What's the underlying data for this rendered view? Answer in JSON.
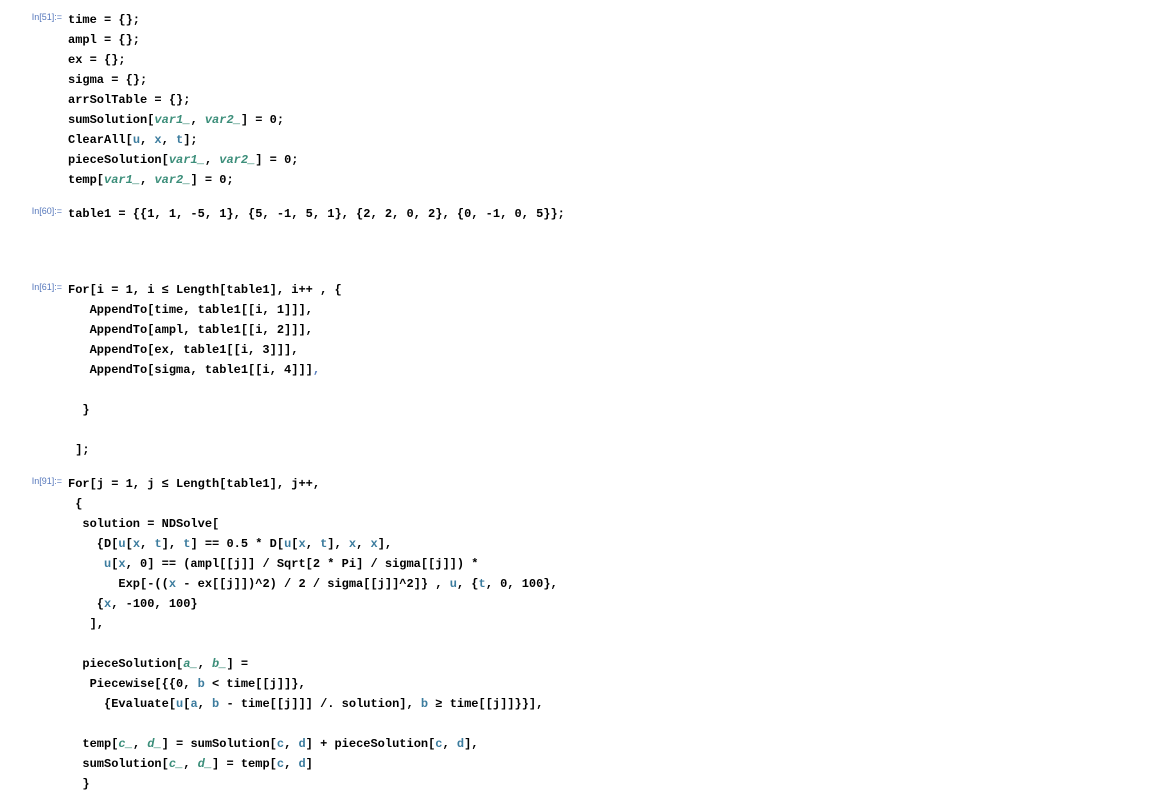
{
  "cells": [
    {
      "label": "In[51]:=",
      "lines": [
        [
          {
            "t": "time = {};",
            "c": "sym"
          }
        ],
        [
          {
            "t": "ampl = {};",
            "c": "sym"
          }
        ],
        [
          {
            "t": "ex = {};",
            "c": "sym"
          }
        ],
        [
          {
            "t": "sigma = {};",
            "c": "sym"
          }
        ],
        [
          {
            "t": "arrSolTable = {};",
            "c": "sym"
          }
        ],
        [
          {
            "t": "sumSolution[",
            "c": "sym"
          },
          {
            "t": "var1_",
            "c": "patt"
          },
          {
            "t": ", ",
            "c": "sym"
          },
          {
            "t": "var2_",
            "c": "patt"
          },
          {
            "t": "] = 0;",
            "c": "sym"
          }
        ],
        [
          {
            "t": "ClearAll[",
            "c": "sym"
          },
          {
            "t": "u",
            "c": "blue"
          },
          {
            "t": ", ",
            "c": "sym"
          },
          {
            "t": "x",
            "c": "blue"
          },
          {
            "t": ", ",
            "c": "sym"
          },
          {
            "t": "t",
            "c": "blue"
          },
          {
            "t": "];",
            "c": "sym"
          }
        ],
        [
          {
            "t": "pieceSolution[",
            "c": "sym"
          },
          {
            "t": "var1_",
            "c": "patt"
          },
          {
            "t": ", ",
            "c": "sym"
          },
          {
            "t": "var2_",
            "c": "patt"
          },
          {
            "t": "] = 0;",
            "c": "sym"
          }
        ],
        [
          {
            "t": "temp[",
            "c": "sym"
          },
          {
            "t": "var1_",
            "c": "patt"
          },
          {
            "t": ", ",
            "c": "sym"
          },
          {
            "t": "var2_",
            "c": "patt"
          },
          {
            "t": "] = 0;",
            "c": "sym"
          }
        ]
      ]
    },
    {
      "label": "In[60]:=",
      "lines": [
        [
          {
            "t": "table1 = {{1, 1, -5, 1}, {5, -1, 5, 1}, {2, 2, 0, 2}, {0, -1, 0, 5}};",
            "c": "sym"
          }
        ]
      ]
    },
    {
      "label": "In[61]:=",
      "lines": [
        [
          {
            "t": "For[i = 1, i ≤ Length[table1], i++ , {",
            "c": "sym"
          }
        ],
        [
          {
            "t": "   AppendTo[time, table1[[i, 1]]],",
            "c": "sym"
          }
        ],
        [
          {
            "t": "   AppendTo[ampl, table1[[i, 2]]],",
            "c": "sym"
          }
        ],
        [
          {
            "t": "   AppendTo[ex, table1[[i, 3]]],",
            "c": "sym"
          }
        ],
        [
          {
            "t": "   AppendTo[sigma, table1[[i, 4]]]",
            "c": "sym"
          },
          {
            "t": ",",
            "c": "comma-trail"
          }
        ],
        [
          {
            "t": " ",
            "c": "sym"
          }
        ],
        [
          {
            "t": "  }",
            "c": "sym"
          }
        ],
        [
          {
            "t": " ",
            "c": "sym"
          }
        ],
        [
          {
            "t": " ];",
            "c": "sym"
          }
        ]
      ]
    },
    {
      "label": "In[91]:=",
      "lines": [
        [
          {
            "t": "For[j = 1, j ≤ Length[table1], j++,",
            "c": "sym"
          }
        ],
        [
          {
            "t": " {",
            "c": "sym"
          }
        ],
        [
          {
            "t": "  solution = NDSolve[",
            "c": "sym"
          }
        ],
        [
          {
            "t": "    {D[",
            "c": "sym"
          },
          {
            "t": "u",
            "c": "blue"
          },
          {
            "t": "[",
            "c": "sym"
          },
          {
            "t": "x",
            "c": "blue"
          },
          {
            "t": ", ",
            "c": "sym"
          },
          {
            "t": "t",
            "c": "blue"
          },
          {
            "t": "], ",
            "c": "sym"
          },
          {
            "t": "t",
            "c": "blue"
          },
          {
            "t": "] == 0.5 * D[",
            "c": "sym"
          },
          {
            "t": "u",
            "c": "blue"
          },
          {
            "t": "[",
            "c": "sym"
          },
          {
            "t": "x",
            "c": "blue"
          },
          {
            "t": ", ",
            "c": "sym"
          },
          {
            "t": "t",
            "c": "blue"
          },
          {
            "t": "], ",
            "c": "sym"
          },
          {
            "t": "x",
            "c": "blue"
          },
          {
            "t": ", ",
            "c": "sym"
          },
          {
            "t": "x",
            "c": "blue"
          },
          {
            "t": "],",
            "c": "sym"
          }
        ],
        [
          {
            "t": "     ",
            "c": "sym"
          },
          {
            "t": "u",
            "c": "blue"
          },
          {
            "t": "[",
            "c": "sym"
          },
          {
            "t": "x",
            "c": "blue"
          },
          {
            "t": ", 0] == (ampl[[j]] / Sqrt[2 * Pi] / sigma[[j]]) *",
            "c": "sym"
          }
        ],
        [
          {
            "t": "       Exp[-((",
            "c": "sym"
          },
          {
            "t": "x",
            "c": "blue"
          },
          {
            "t": " - ex[[j]])^2) / 2 / sigma[[j]]^2]} , ",
            "c": "sym"
          },
          {
            "t": "u",
            "c": "blue"
          },
          {
            "t": ", {",
            "c": "sym"
          },
          {
            "t": "t",
            "c": "blue"
          },
          {
            "t": ", 0, 100},",
            "c": "sym"
          }
        ],
        [
          {
            "t": "    {",
            "c": "sym"
          },
          {
            "t": "x",
            "c": "blue"
          },
          {
            "t": ", -100, 100}",
            "c": "sym"
          }
        ],
        [
          {
            "t": "   ],",
            "c": "sym"
          }
        ],
        [
          {
            "t": " ",
            "c": "sym"
          }
        ],
        [
          {
            "t": "  pieceSolution[",
            "c": "sym"
          },
          {
            "t": "a_",
            "c": "patt"
          },
          {
            "t": ", ",
            "c": "sym"
          },
          {
            "t": "b_",
            "c": "patt"
          },
          {
            "t": "] =",
            "c": "sym"
          }
        ],
        [
          {
            "t": "   Piecewise[{{0, ",
            "c": "sym"
          },
          {
            "t": "b",
            "c": "blue"
          },
          {
            "t": " < time[[j]]},",
            "c": "sym"
          }
        ],
        [
          {
            "t": "     {Evaluate[",
            "c": "sym"
          },
          {
            "t": "u",
            "c": "blue"
          },
          {
            "t": "[",
            "c": "sym"
          },
          {
            "t": "a",
            "c": "blue"
          },
          {
            "t": ", ",
            "c": "sym"
          },
          {
            "t": "b",
            "c": "blue"
          },
          {
            "t": " - time[[j]]] /. solution], ",
            "c": "sym"
          },
          {
            "t": "b",
            "c": "blue"
          },
          {
            "t": " ≥ time[[j]]}}],",
            "c": "sym"
          }
        ],
        [
          {
            "t": " ",
            "c": "sym"
          }
        ],
        [
          {
            "t": "  temp[",
            "c": "sym"
          },
          {
            "t": "c_",
            "c": "patt"
          },
          {
            "t": ", ",
            "c": "sym"
          },
          {
            "t": "d_",
            "c": "patt"
          },
          {
            "t": "] = sumSolution[",
            "c": "sym"
          },
          {
            "t": "c",
            "c": "blue"
          },
          {
            "t": ", ",
            "c": "sym"
          },
          {
            "t": "d",
            "c": "blue"
          },
          {
            "t": "] + pieceSolution[",
            "c": "sym"
          },
          {
            "t": "c",
            "c": "blue"
          },
          {
            "t": ", ",
            "c": "sym"
          },
          {
            "t": "d",
            "c": "blue"
          },
          {
            "t": "],",
            "c": "sym"
          }
        ],
        [
          {
            "t": "  sumSolution[",
            "c": "sym"
          },
          {
            "t": "c_",
            "c": "patt"
          },
          {
            "t": ", ",
            "c": "sym"
          },
          {
            "t": "d_",
            "c": "patt"
          },
          {
            "t": "] = temp[",
            "c": "sym"
          },
          {
            "t": "c",
            "c": "blue"
          },
          {
            "t": ", ",
            "c": "sym"
          },
          {
            "t": "d",
            "c": "blue"
          },
          {
            "t": "]",
            "c": "sym"
          }
        ],
        [
          {
            "t": "  }",
            "c": "sym"
          }
        ]
      ]
    }
  ]
}
